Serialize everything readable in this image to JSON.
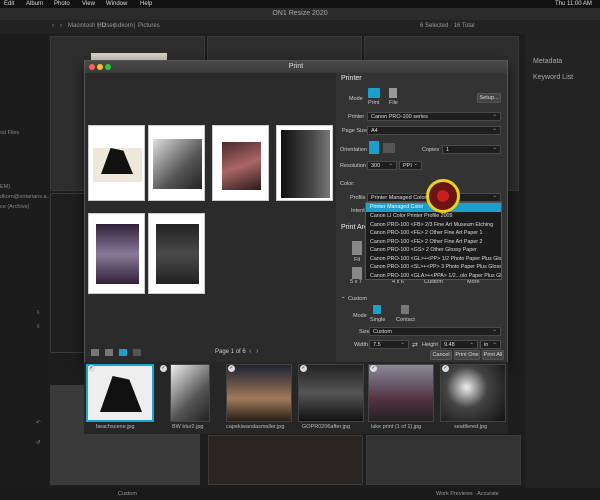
{
  "menubar": {
    "edit": "Edit",
    "album": "Album",
    "photo": "Photo",
    "view": "View",
    "window": "Window",
    "help": "Help",
    "clock": "Thu 11:00 AM"
  },
  "app": {
    "title": "ON1 Resize 2020",
    "selection": "6 Selected · 16 Total"
  },
  "path": {
    "crumbs": [
      "Macintosh HD",
      "Users",
      "dkorn",
      "Pictures"
    ]
  },
  "leftstrip": {
    "items": [
      "od Files",
      "EM)",
      "dkorn@ontarians.a...",
      "ce (Archive)"
    ]
  },
  "rightpanel": {
    "metadata": "Metadata",
    "keywords": "Keyword List"
  },
  "print_dialog": {
    "title": "Print",
    "page_indicator": "Page 1 of 6",
    "settings": {
      "header": "Printer",
      "mode_label": "Mode",
      "mode_print": "Print",
      "mode_file": "File",
      "setup_button": "Setup...",
      "printer_label": "Printer",
      "printer_value": "Canon PRO-100 series",
      "pagesize_label": "Page Size",
      "pagesize_value": "A4",
      "orientation_label": "Orientation",
      "copies_label": "Copies",
      "copies_value": "1",
      "resolution_label": "Resolution",
      "resolution_value": "300",
      "resolution_unit": "PPI",
      "color_label": "Color:",
      "profile_label": "Profile",
      "profile_value": "Printer Managed Color",
      "intent_label": "Intent",
      "print_area_header": "Print Are",
      "fit_label": "Fit",
      "size_5x7": "5 x 7",
      "size_4x6": "4 x 6",
      "custom_tile": "Custom",
      "more_tile": "More",
      "custom_section": "Custom",
      "custom_mode_label": "Mode",
      "mode_single": "Single",
      "mode_contact": "Contact",
      "size_label": "Size",
      "size_value": "Custom",
      "width_label": "Width",
      "width_value": "7.5",
      "height_label": "Height",
      "height_value": "9.48",
      "unit_value": "in",
      "cancel_button": "Cancel",
      "printone_button": "Print One",
      "printall_button": "Print All"
    },
    "profile_options": [
      "Printer Managed Color",
      "Canon LI Color Printer Profile 2009",
      "Canon PRO-100 <FB> 2/3 Fine Art Museum Etching",
      "Canon PRO-100 <FE> 2 Other Fine Art Paper 1",
      "Canon PRO-100 <FE> 2 Other Fine Art Paper 2",
      "Canon PRO-100 <GS> 2 Other Glossy Paper",
      "Canon PRO-100 <GL>+<PP> 1/2 Photo Paper Plus Glossy&Gold",
      "Canon PRO-100 <SL>+<PP> 3 Photo Paper Plus Glossy&Gold",
      "Canon PRO-100 <GLA>+<PPA> 1/2...olo Paper Plus Glossy&Gold A"
    ]
  },
  "filmstrip": {
    "files": [
      "beachscene.jpg",
      "BW blur2.jpg",
      "capekiwandasmaller.jpg",
      "GOPR0206after.jpg",
      "lake print (1 of 1).jpg",
      "seattlered.jpg"
    ]
  },
  "bottombar": {
    "left": "Custom",
    "right": "Work Previews · Accurate"
  },
  "colors": {
    "accent": "#1a9fcf",
    "highlight_ring": "#e6d219",
    "background": "#1d1d1d"
  }
}
